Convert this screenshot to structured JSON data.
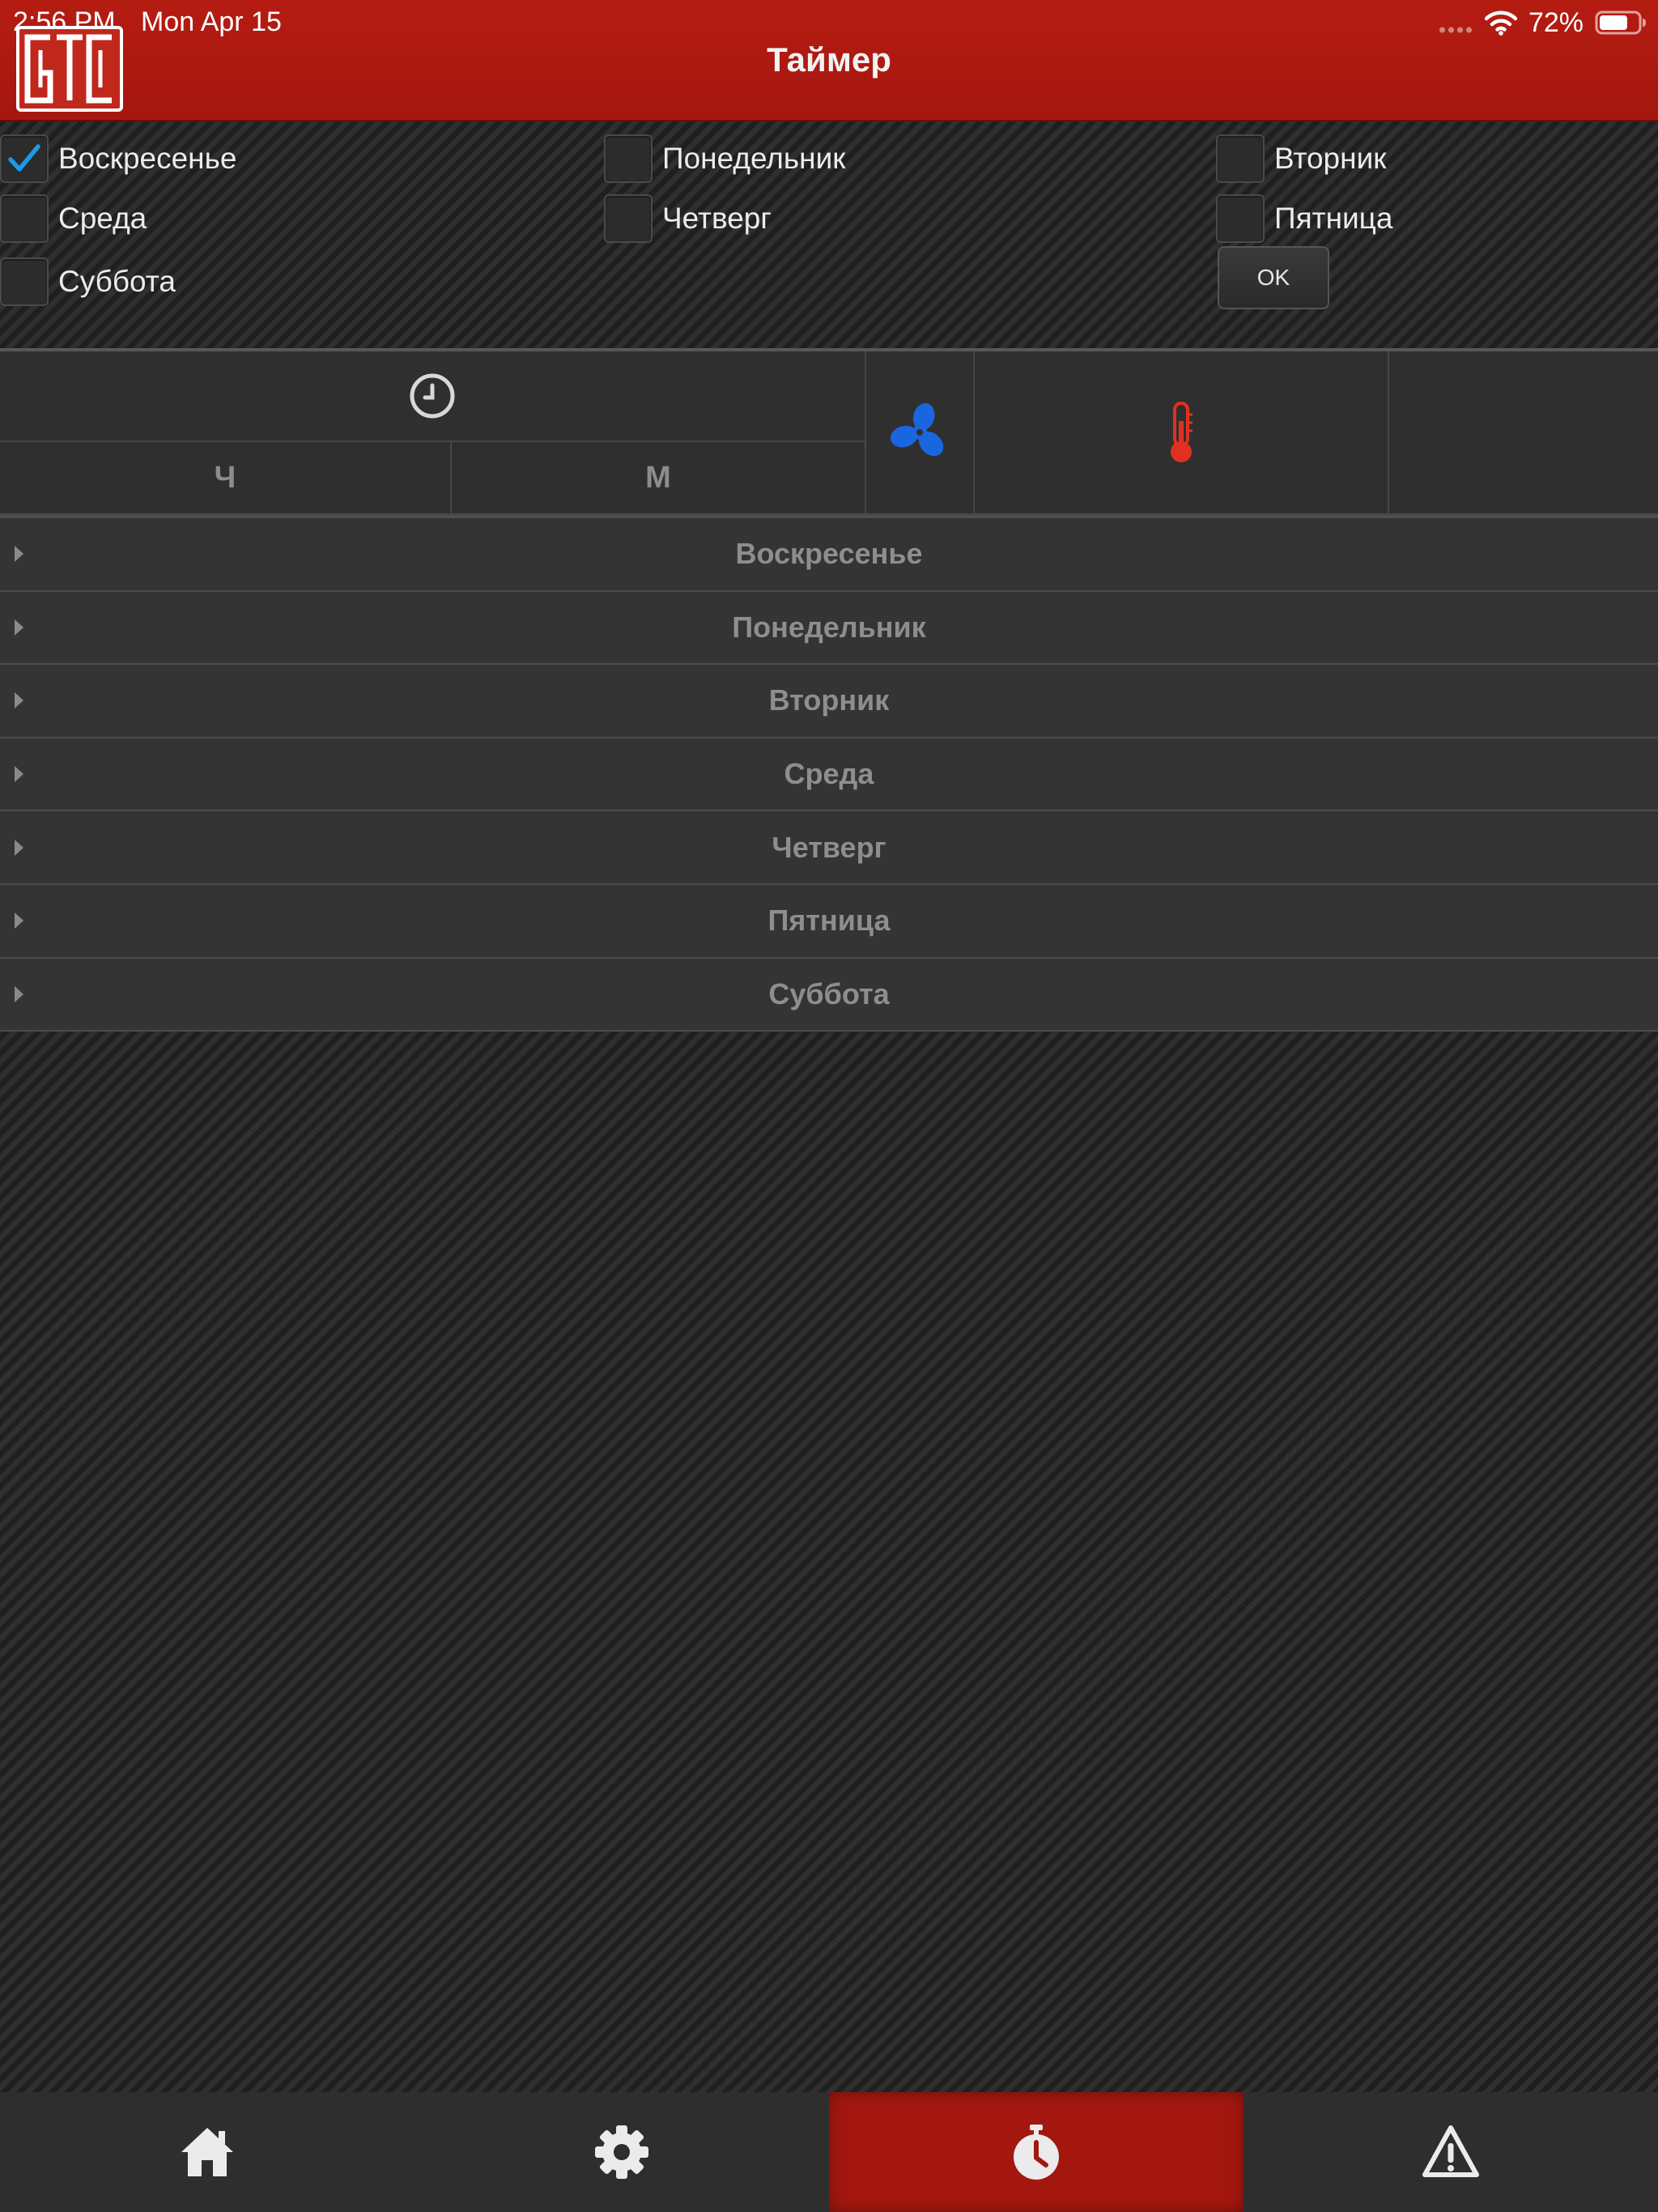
{
  "status_bar": {
    "time": "2:56 PM",
    "date": "Mon Apr 15",
    "battery": "72%"
  },
  "header": {
    "title": "Таймер",
    "logo": "gtc-logo"
  },
  "day_selector": {
    "days": [
      {
        "label": "Воскресенье",
        "checked": true
      },
      {
        "label": "Понедельник",
        "checked": false
      },
      {
        "label": "Вторник",
        "checked": false
      },
      {
        "label": "Среда",
        "checked": false
      },
      {
        "label": "Четверг",
        "checked": false
      },
      {
        "label": "Пятница",
        "checked": false
      },
      {
        "label": "Суббота",
        "checked": false
      }
    ],
    "ok_label": "OK"
  },
  "schedule": {
    "columns": {
      "time_icon": "clock-icon",
      "hours_label": "Ч",
      "minutes_label": "М",
      "fan_icon": "fan-icon",
      "temperature_icon": "thermometer-icon"
    },
    "rows": [
      {
        "label": "Воскресенье"
      },
      {
        "label": "Понедельник"
      },
      {
        "label": "Вторник"
      },
      {
        "label": "Среда"
      },
      {
        "label": "Четверг"
      },
      {
        "label": "Пятница"
      },
      {
        "label": "Суббота"
      }
    ]
  },
  "tabbar": {
    "tabs": [
      {
        "name": "home",
        "icon": "home-icon",
        "active": false
      },
      {
        "name": "settings",
        "icon": "gear-icon",
        "active": false
      },
      {
        "name": "timer",
        "icon": "stopwatch-icon",
        "active": true
      },
      {
        "name": "alerts",
        "icon": "warning-icon",
        "active": false
      }
    ]
  },
  "colors": {
    "header_red": "#a5170f",
    "checkmark_blue": "#1a9be8",
    "fan_blue": "#1a66e0",
    "thermometer_red": "#e03020"
  }
}
